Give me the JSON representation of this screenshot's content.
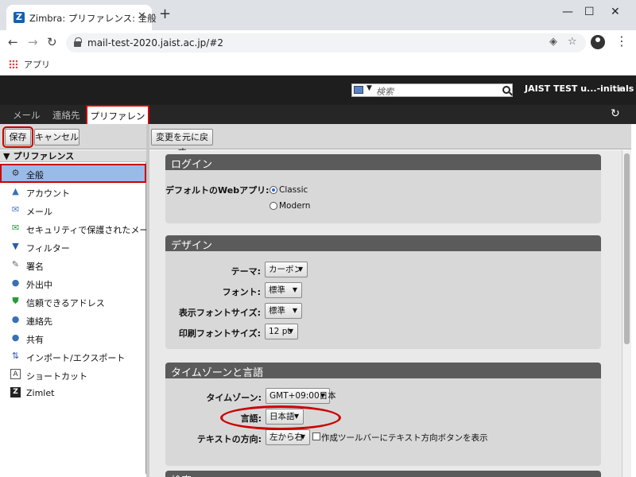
{
  "browser": {
    "tab_title": "Zimbra: プリファレンス: 全般",
    "favicon_letter": "Z",
    "url": "mail-test-2020.jaist.ac.jp/#2",
    "bookmark_apps": "アプリ"
  },
  "header": {
    "search_placeholder": "検索",
    "user_name": "JAIST TEST u...-initials"
  },
  "app_tabs": [
    "メール",
    "連絡先",
    "プリファレンス"
  ],
  "left_toolbar": {
    "save": "保存",
    "cancel": "キャンセル"
  },
  "right_toolbar": {
    "revert": "変更を元に戻す"
  },
  "tree": {
    "heading": "プリファレンス",
    "items": [
      {
        "label": "全般",
        "icon": "gear-icon"
      },
      {
        "label": "アカウント",
        "icon": "account-icon"
      },
      {
        "label": "メール",
        "icon": "mail-icon"
      },
      {
        "label": "セキュリティで保護されたメール",
        "icon": "secure-mail-icon"
      },
      {
        "label": "フィルター",
        "icon": "filter-icon"
      },
      {
        "label": "署名",
        "icon": "signature-icon"
      },
      {
        "label": "外出中",
        "icon": "out-of-office-icon"
      },
      {
        "label": "信頼できるアドレス",
        "icon": "shield-icon"
      },
      {
        "label": "連絡先",
        "icon": "contact-icon"
      },
      {
        "label": "共有",
        "icon": "share-icon"
      },
      {
        "label": "インポート/エクスポート",
        "icon": "import-export-icon"
      },
      {
        "label": "ショートカット",
        "icon": "shortcut-icon"
      },
      {
        "label": "Zimlet",
        "icon": "zimlet-icon"
      }
    ]
  },
  "login": {
    "title": "ログイン",
    "default_web_app_label": "デフォルトのWebアプリ:",
    "options": [
      "Classic",
      "Modern"
    ],
    "selected": "Classic"
  },
  "design": {
    "title": "デザイン",
    "theme_label": "テーマ:",
    "theme_value": "カーボン",
    "font_label": "フォント:",
    "font_value": "標準",
    "display_font_size_label": "表示フォントサイズ:",
    "display_font_size_value": "標準",
    "print_font_size_label": "印刷フォントサイズ:",
    "print_font_size_value": "12 pt"
  },
  "timezone": {
    "title": "タイムゾーンと言語",
    "timezone_label": "タイムゾーン:",
    "timezone_value": "GMT+09:00日本",
    "language_label": "言語:",
    "language_value": "日本語",
    "text_direction_label": "テキストの方向:",
    "text_direction_value": "左から右",
    "show_direction_button_label": "作成ツールバーにテキスト方向ボタンを表示",
    "show_direction_button_checked": false
  },
  "next_section_title": "検索"
}
